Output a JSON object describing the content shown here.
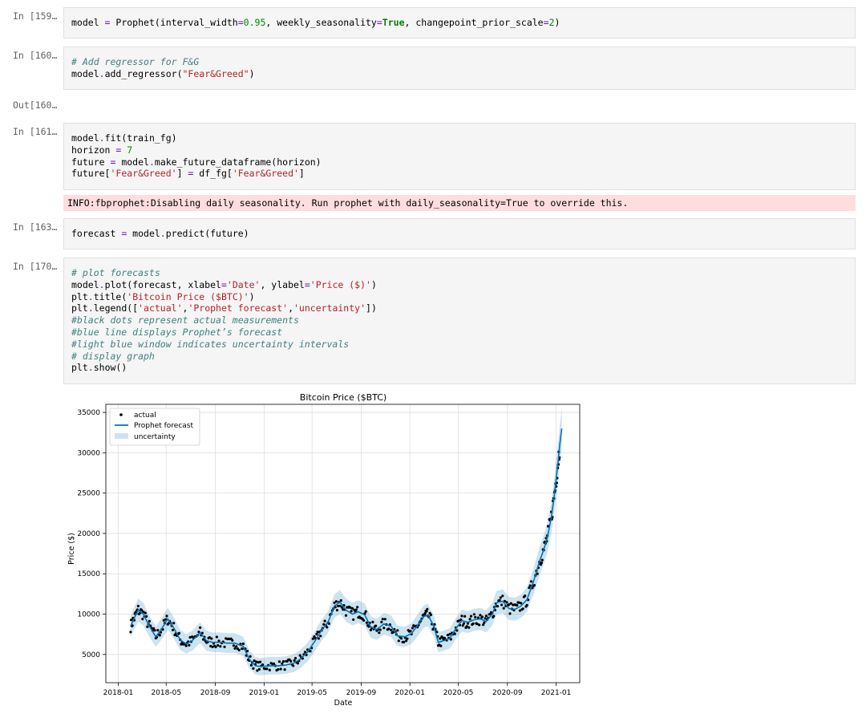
{
  "cells": [
    {
      "prompt": "In [159…",
      "lines": [
        [
          [
            "t",
            "model "
          ],
          [
            "o",
            "="
          ],
          [
            "t",
            " Prophet(interval_width"
          ],
          [
            "o",
            "="
          ],
          [
            "n",
            "0.95"
          ],
          [
            "t",
            ", weekly_seasonality"
          ],
          [
            "o",
            "="
          ],
          [
            "k",
            "True"
          ],
          [
            "t",
            ", changepoint_prior_scale"
          ],
          [
            "o",
            "="
          ],
          [
            "n",
            "2"
          ],
          [
            "t",
            ")"
          ]
        ]
      ]
    },
    {
      "prompt": "In [160…",
      "lines": [
        [
          [
            "c",
            "# Add regressor for F&G"
          ]
        ],
        [
          [
            "t",
            "model"
          ],
          [
            "o",
            "."
          ],
          [
            "t",
            "add_regressor("
          ],
          [
            "s",
            "\"Fear&Greed\""
          ],
          [
            "t",
            ")"
          ]
        ]
      ]
    },
    {
      "prompt": "In [161…",
      "lines": [
        [
          [
            "t",
            "model"
          ],
          [
            "o",
            "."
          ],
          [
            "t",
            "fit(train_fg)"
          ]
        ],
        [
          [
            "t",
            "horizon "
          ],
          [
            "o",
            "="
          ],
          [
            "t",
            " "
          ],
          [
            "n",
            "7"
          ]
        ],
        [
          [
            "t",
            "future "
          ],
          [
            "o",
            "="
          ],
          [
            "t",
            " model"
          ],
          [
            "o",
            "."
          ],
          [
            "t",
            "make_future_dataframe(horizon)"
          ]
        ],
        [
          [
            "t",
            "future["
          ],
          [
            "s",
            "'Fear&Greed'"
          ],
          [
            "t",
            "] "
          ],
          [
            "o",
            "="
          ],
          [
            "t",
            " df_fg["
          ],
          [
            "s",
            "'Fear&Greed'"
          ],
          [
            "t",
            "]"
          ]
        ]
      ]
    },
    {
      "prompt": "In [163…",
      "lines": [
        [
          [
            "t",
            "forecast "
          ],
          [
            "o",
            "="
          ],
          [
            "t",
            " model"
          ],
          [
            "o",
            "."
          ],
          [
            "t",
            "predict(future)"
          ]
        ]
      ]
    },
    {
      "prompt": "In [170…",
      "lines": [
        [
          [
            "c",
            "# plot forecasts"
          ]
        ],
        [
          [
            "t",
            "model"
          ],
          [
            "o",
            "."
          ],
          [
            "t",
            "plot(forecast, xlabel"
          ],
          [
            "o",
            "="
          ],
          [
            "s",
            "'Date'"
          ],
          [
            "t",
            ", ylabel"
          ],
          [
            "o",
            "="
          ],
          [
            "s",
            "'Price ($)'"
          ],
          [
            "t",
            ")"
          ]
        ],
        [
          [
            "t",
            "plt"
          ],
          [
            "o",
            "."
          ],
          [
            "t",
            "title("
          ],
          [
            "s",
            "'Bitcoin Price ($BTC)'"
          ],
          [
            "t",
            ")"
          ]
        ],
        [
          [
            "t",
            "plt"
          ],
          [
            "o",
            "."
          ],
          [
            "t",
            "legend(["
          ],
          [
            "s",
            "'actual'"
          ],
          [
            "t",
            ","
          ],
          [
            "s",
            "'Prophet forecast'"
          ],
          [
            "t",
            ","
          ],
          [
            "s",
            "'uncertainty'"
          ],
          [
            "t",
            "])"
          ]
        ],
        [
          [
            "c",
            "#black dots represent actual measurements"
          ]
        ],
        [
          [
            "c",
            "#blue line displays Prophet’s forecast"
          ]
        ],
        [
          [
            "c",
            "#light blue window indicates uncertainty intervals"
          ]
        ],
        [
          [
            "c",
            "# display graph"
          ]
        ],
        [
          [
            "t",
            "plt"
          ],
          [
            "o",
            "."
          ],
          [
            "t",
            "show()"
          ]
        ]
      ]
    }
  ],
  "out_prompt": "Out[160…",
  "stderr_text": "INFO:fbprophet:Disabling daily seasonality. Run prophet with daily_seasonality=True to override this.",
  "chart_data": {
    "type": "line",
    "title": "Bitcoin Price ($BTC)",
    "xlabel": "Date",
    "ylabel": "Price ($)",
    "xlim": [
      "2017-12-01",
      "2021-03-01"
    ],
    "ylim": [
      1500,
      36000
    ],
    "xticks": [
      "2018-01",
      "2018-05",
      "2018-09",
      "2019-01",
      "2019-05",
      "2019-09",
      "2020-01",
      "2020-05",
      "2020-09",
      "2021-01"
    ],
    "yticks": [
      5000,
      10000,
      15000,
      20000,
      25000,
      30000,
      35000
    ],
    "grid": true,
    "legend_position": "top-left",
    "legend": [
      "actual",
      "Prophet forecast",
      "uncertainty"
    ],
    "colors": {
      "actual": "#000000",
      "forecast": "#0072b2",
      "uncertainty": "#a6c8e3"
    },
    "series": [
      {
        "name": "Prophet forecast",
        "x": [
          "2018-02-01",
          "2018-02-10",
          "2018-02-20",
          "2018-03-05",
          "2018-03-20",
          "2018-04-05",
          "2018-04-20",
          "2018-05-05",
          "2018-05-20",
          "2018-06-05",
          "2018-06-20",
          "2018-07-05",
          "2018-07-25",
          "2018-08-10",
          "2018-08-25",
          "2018-09-10",
          "2018-10-01",
          "2018-10-20",
          "2018-11-10",
          "2018-11-25",
          "2018-12-10",
          "2018-12-25",
          "2019-01-15",
          "2019-02-05",
          "2019-02-25",
          "2019-03-15",
          "2019-04-01",
          "2019-04-20",
          "2019-05-10",
          "2019-05-25",
          "2019-06-10",
          "2019-06-26",
          "2019-07-10",
          "2019-07-25",
          "2019-08-10",
          "2019-08-25",
          "2019-09-10",
          "2019-09-25",
          "2019-10-10",
          "2019-10-28",
          "2019-11-15",
          "2019-12-01",
          "2019-12-20",
          "2020-01-05",
          "2020-01-20",
          "2020-02-05",
          "2020-02-15",
          "2020-03-01",
          "2020-03-12",
          "2020-03-25",
          "2020-04-10",
          "2020-04-25",
          "2020-05-10",
          "2020-05-25",
          "2020-06-10",
          "2020-06-25",
          "2020-07-10",
          "2020-07-25",
          "2020-08-05",
          "2020-08-20",
          "2020-09-05",
          "2020-09-20",
          "2020-10-05",
          "2020-10-20",
          "2020-11-05",
          "2020-11-20",
          "2020-12-01",
          "2020-12-10",
          "2020-12-20",
          "2020-12-28",
          "2021-01-05",
          "2021-01-10",
          "2021-01-15"
        ],
        "values": [
          8500,
          9500,
          10500,
          10000,
          8500,
          7200,
          8200,
          9400,
          8300,
          6800,
          6300,
          6700,
          7700,
          6700,
          6500,
          6500,
          6400,
          6400,
          6000,
          4400,
          3600,
          3500,
          3600,
          3600,
          3700,
          3900,
          4400,
          5300,
          6800,
          8000,
          9000,
          11000,
          11500,
          10500,
          10000,
          10300,
          9900,
          8400,
          8100,
          8800,
          8500,
          7300,
          7200,
          7600,
          8600,
          9700,
          9900,
          8500,
          6500,
          6700,
          7000,
          8200,
          9200,
          9000,
          9300,
          9400,
          9100,
          10000,
          11400,
          11600,
          10700,
          10600,
          11000,
          11800,
          14000,
          16500,
          18000,
          19500,
          22000,
          25000,
          28500,
          31000,
          33000
        ]
      }
    ]
  }
}
